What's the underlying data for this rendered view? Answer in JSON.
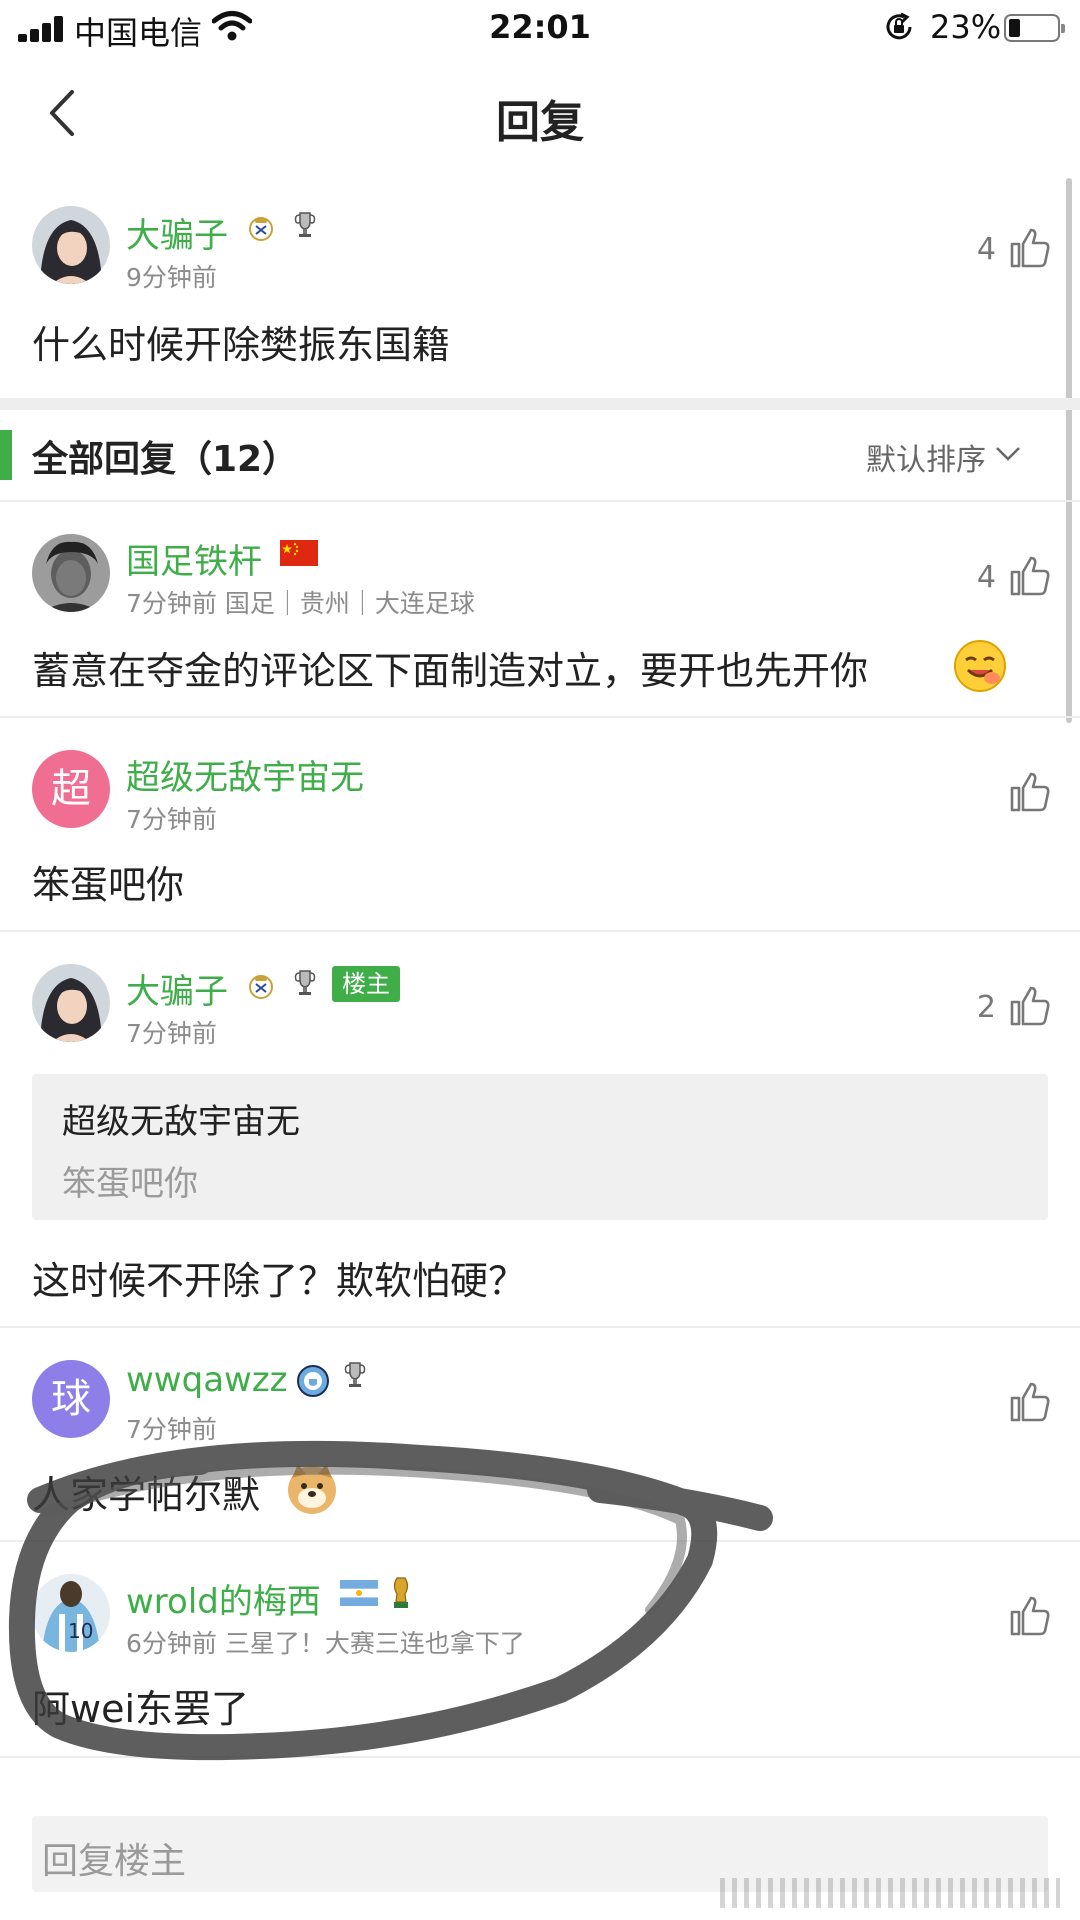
{
  "status_bar": {
    "carrier": "中国电信",
    "time": "22:01",
    "battery": "23%",
    "battery_level": 0.23
  },
  "nav": {
    "title": "回复"
  },
  "main_comment": {
    "username": "大骗子",
    "time": "9分钟前",
    "text": "什么时候开除樊振东国籍",
    "likes": "4"
  },
  "replies_header": {
    "title": "全部回复（12）",
    "sort": "默认排序"
  },
  "replies": [
    {
      "username": "国足铁杆",
      "meta": "7分钟前 国足｜贵州｜大连足球",
      "text": "蓄意在夺金的评论区下面制造对立，要开也先开你",
      "likes": "4"
    },
    {
      "avatar_letter": "超",
      "username": "超级无敌宇宙无",
      "meta": "7分钟前",
      "text": "笨蛋吧你",
      "likes": ""
    },
    {
      "username": "大骗子",
      "tag": "楼主",
      "meta": "7分钟前",
      "quote_name": "超级无敌宇宙无",
      "quote_text": "笨蛋吧你",
      "text": "这时候不开除了？欺软怕硬？",
      "likes": "2"
    },
    {
      "avatar_letter": "球",
      "username": "wwqawzz",
      "meta": "7分钟前",
      "text": "人家学帕尔默",
      "likes": ""
    },
    {
      "username": "wrold的梅西",
      "meta": "6分钟前 三星了！大赛三连也拿下了",
      "text": "阿wei东罢了",
      "likes": ""
    }
  ],
  "reply_bar": {
    "placeholder": "回复楼主"
  },
  "colors": {
    "accent": "#3fae49",
    "avatar_pink": "#f06e92",
    "avatar_purple": "#8e7ee8"
  },
  "icons": [
    "signal-icon",
    "wifi-icon",
    "rotation-lock-icon",
    "battery-icon",
    "back-arrow-icon",
    "thumbs-up-icon",
    "chevron-down-icon",
    "real-madrid-badge-icon",
    "champions-trophy-icon",
    "china-flag-icon",
    "man-city-badge-icon",
    "argentina-flag-icon",
    "world-cup-trophy-icon",
    "emoji-icon",
    "doge-emoji-icon"
  ]
}
